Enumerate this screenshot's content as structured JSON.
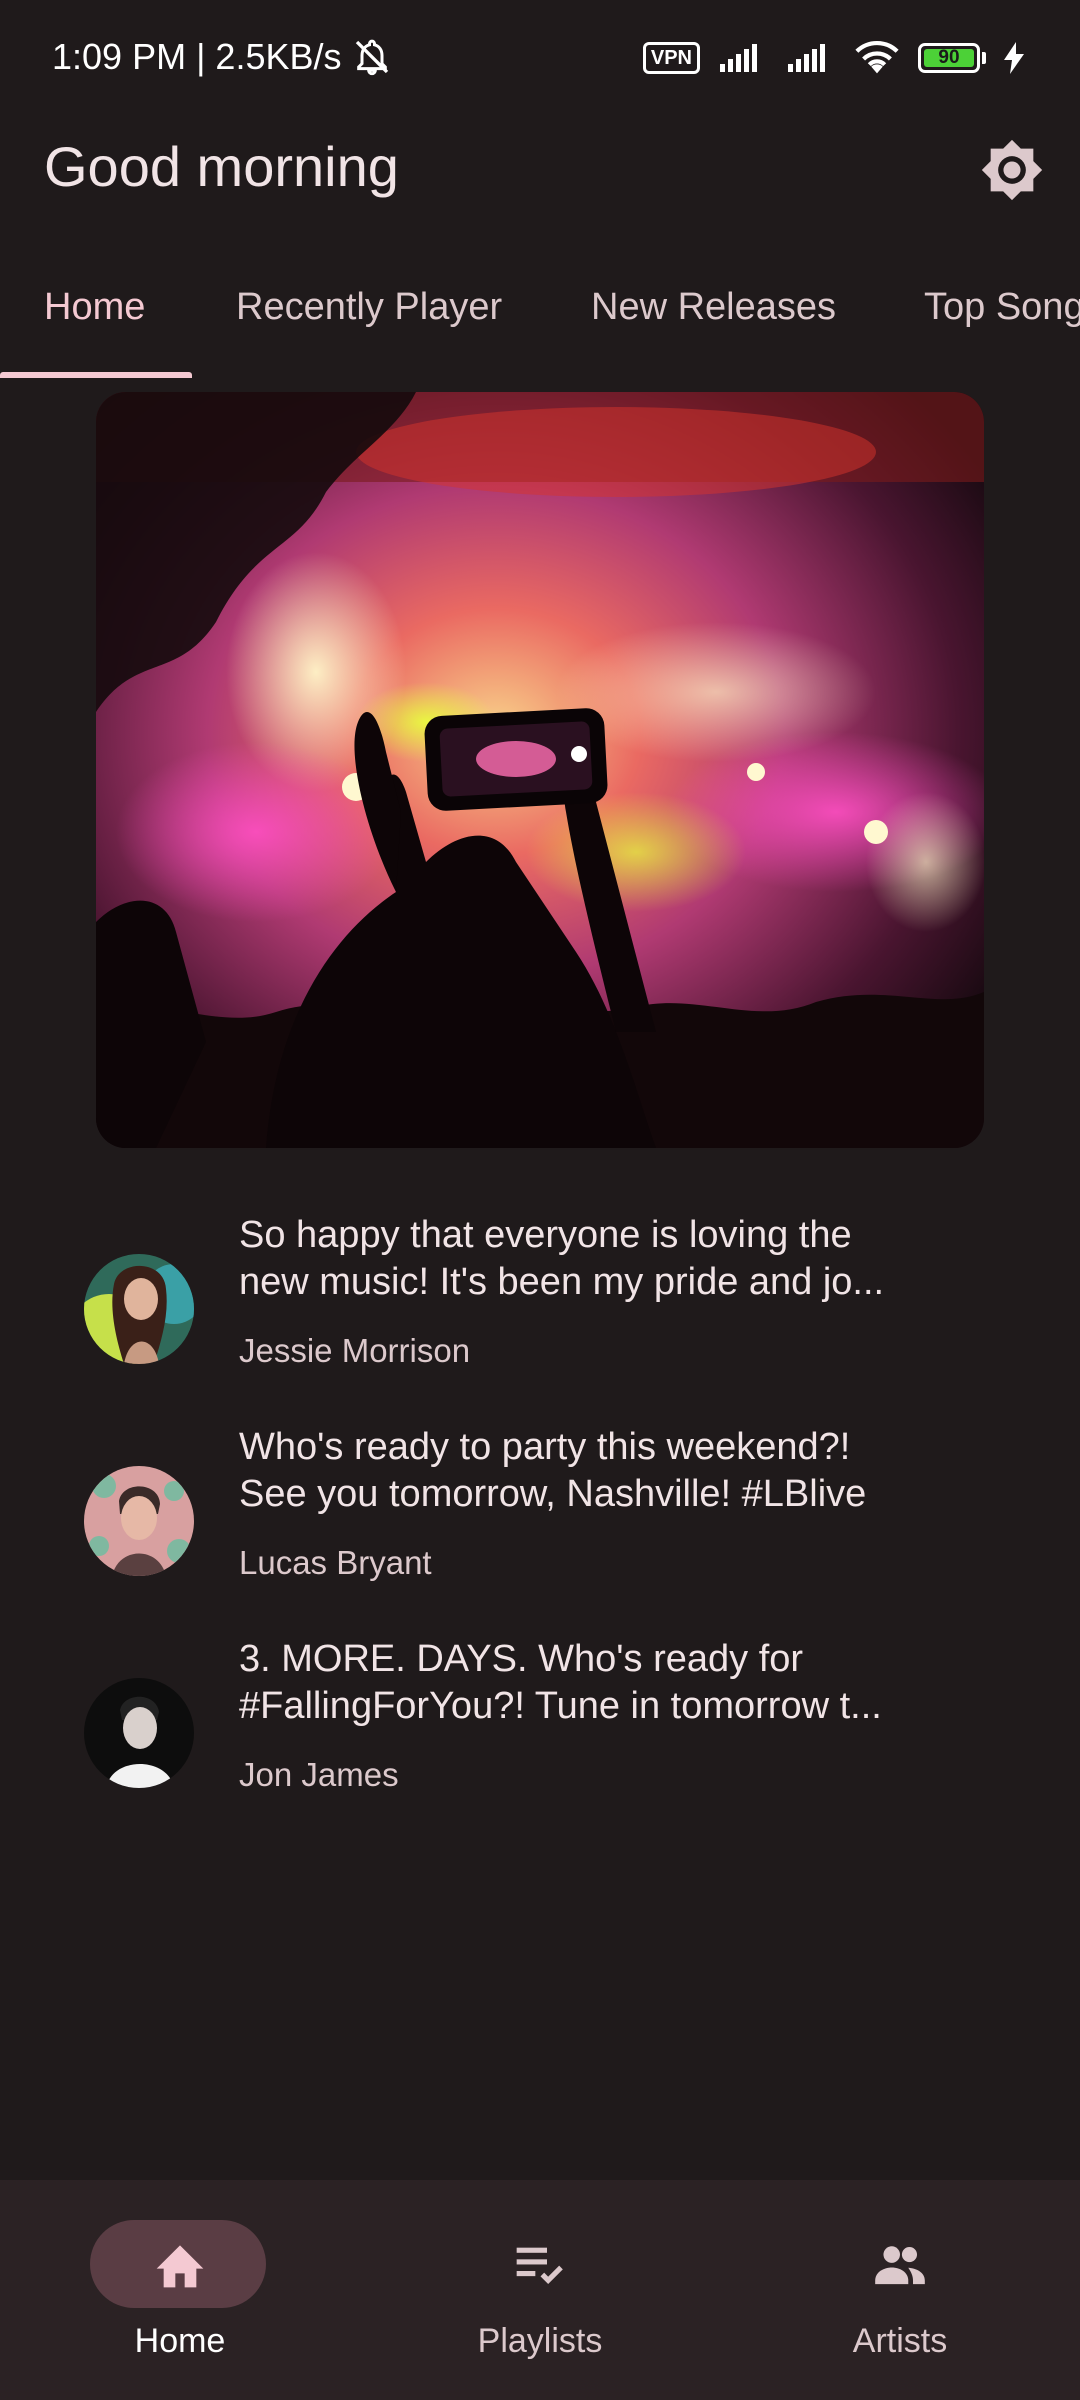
{
  "status_bar": {
    "time_speed": "1:09 PM | 2.5KB/s",
    "vpn": "VPN",
    "battery": "90"
  },
  "header": {
    "greeting": "Good morning"
  },
  "tabs": [
    {
      "label": "Home",
      "active": true
    },
    {
      "label": "Recently Player",
      "active": false
    },
    {
      "label": "New Releases",
      "active": false
    },
    {
      "label": "Top Songs",
      "active": false
    }
  ],
  "feed": [
    {
      "line1": "So happy that everyone is loving the",
      "line2": "new music! It's been my pride and jo...",
      "author": "Jessie Morrison"
    },
    {
      "line1": "Who's ready to party this weekend?!",
      "line2": "See you tomorrow, Nashville! #LBlive",
      "author": "Lucas Bryant"
    },
    {
      "line1": "3. MORE. DAYS. Who's ready for",
      "line2": "#FallingForYou?! Tune in tomorrow t...",
      "author": "Jon James"
    }
  ],
  "bottom_nav": [
    {
      "label": "Home",
      "icon": "home-icon",
      "active": true
    },
    {
      "label": "Playlists",
      "icon": "playlist-check-icon",
      "active": false
    },
    {
      "label": "Artists",
      "icon": "group-icon",
      "active": false
    }
  ],
  "colors": {
    "background": "#1f1a1b",
    "accent": "#f4c9d2",
    "nav_background": "#2b2224",
    "active_pill": "#5a3d44"
  }
}
